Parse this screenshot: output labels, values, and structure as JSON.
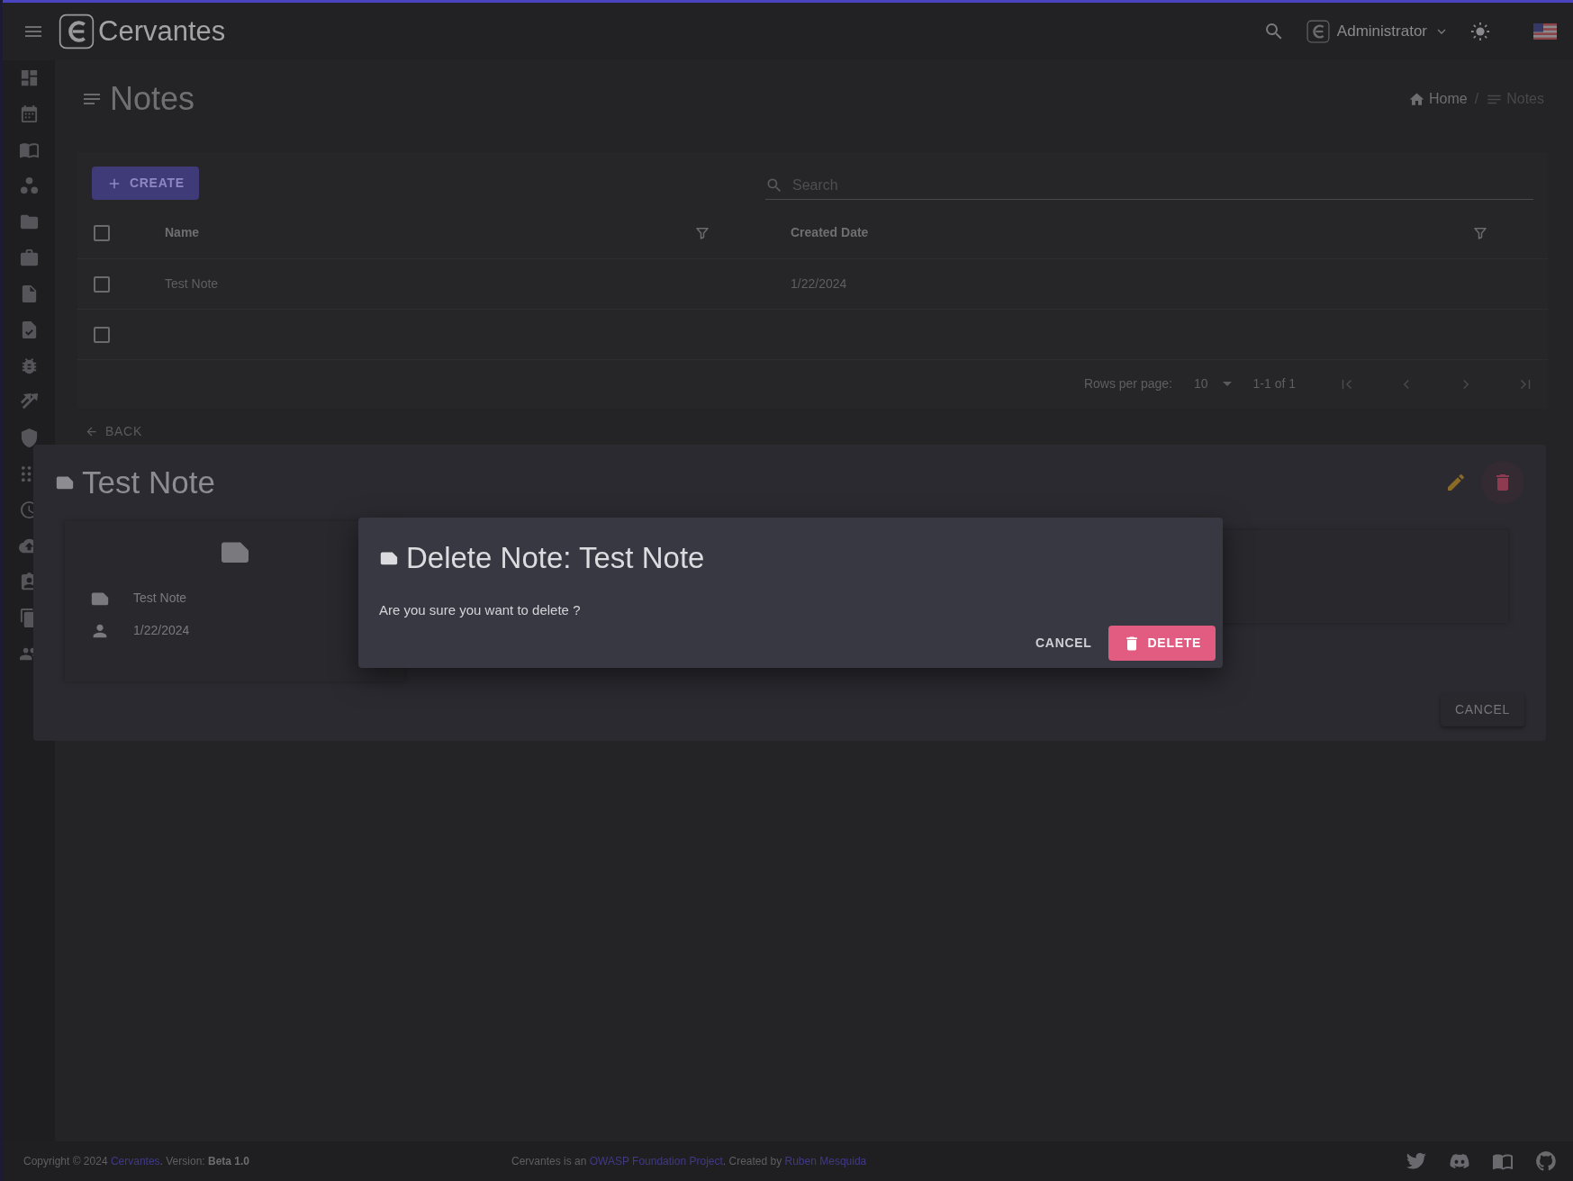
{
  "app": {
    "title": "Cervantes"
  },
  "topbar": {
    "user": "Administrator"
  },
  "page": {
    "title": "Notes",
    "breadcrumb_separator": "/",
    "breadcrumb": [
      {
        "label": "Home",
        "current": false
      },
      {
        "label": "Notes",
        "current": true
      }
    ]
  },
  "toolbar": {
    "create": "CREATE",
    "search": {
      "placeholder": "Search"
    }
  },
  "table": {
    "select_all_checked": false,
    "columns": [
      "Name",
      "Created Date"
    ],
    "rows": [
      {
        "checked": false,
        "cells": [
          "Test Note",
          "1/22/2024"
        ]
      },
      {
        "checked": false
      }
    ]
  },
  "pagination": {
    "rows_per_page_label": "Rows per page:",
    "rows_per_page": "10",
    "range": "1-1 of 1"
  },
  "back": "BACK",
  "detail": {
    "title": "Test Note",
    "fields": [
      {
        "kind": "note",
        "value": "Test Note"
      },
      {
        "kind": "user",
        "value": "1/22/2024"
      }
    ],
    "cancel": "CANCEL"
  },
  "dialog": {
    "title": "Delete Note: Test Note",
    "message": "Are you sure you want to delete ?",
    "cancel": "CANCEL",
    "confirm": "DELETE"
  },
  "footer": {
    "copyright": [
      {
        "kind": "text",
        "text": "Copyright © 2024 "
      },
      {
        "kind": "link",
        "text": "Cervantes"
      },
      {
        "kind": "text",
        "text": ". Version: **Beta 1.0**"
      }
    ],
    "credit": [
      {
        "kind": "text",
        "text": "Cervantes is an "
      },
      {
        "kind": "link",
        "text": "OWASP Foundation Project"
      },
      {
        "kind": "text",
        "text": ". Created by "
      },
      {
        "kind": "link",
        "text": "Ruben Mesquida"
      }
    ]
  }
}
